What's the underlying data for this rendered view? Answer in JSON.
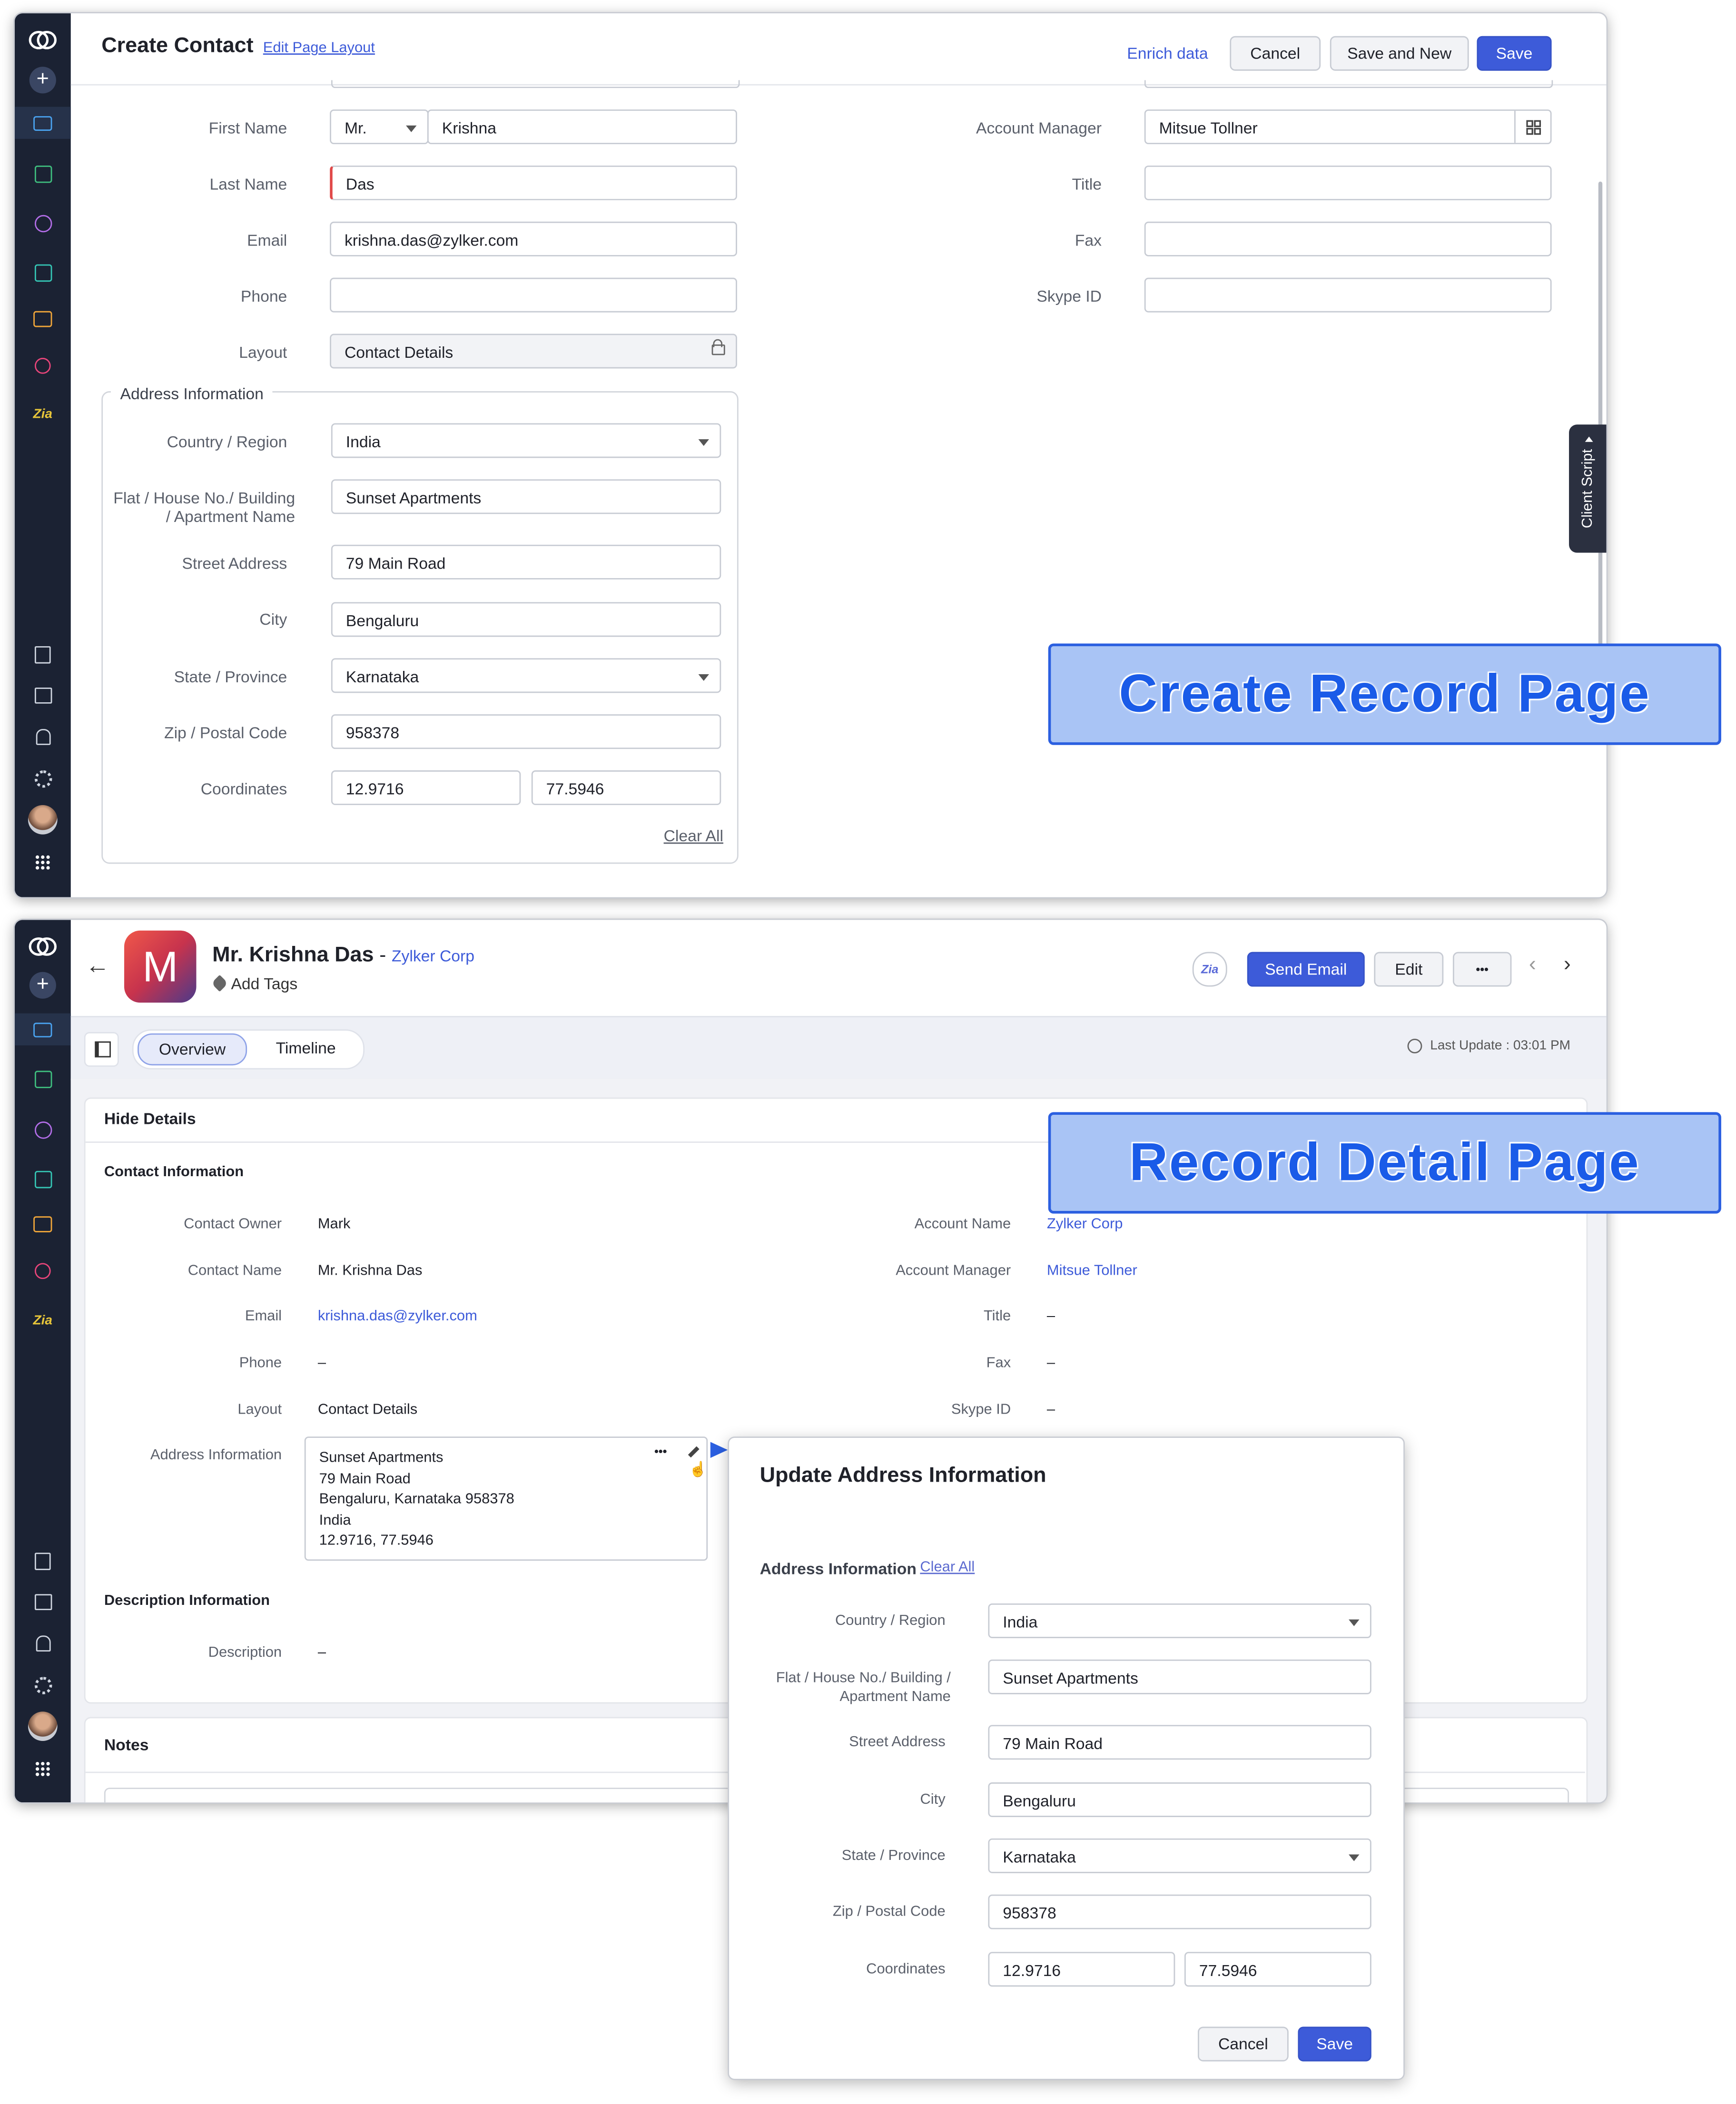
{
  "create_page": {
    "title": "Create Contact",
    "edit_layout": "Edit Page Layout",
    "enrich": "Enrich data",
    "cancel": "Cancel",
    "save_new": "Save and New",
    "save": "Save",
    "labels": {
      "first_name": "First Name",
      "last_name": "Last Name",
      "email": "Email",
      "phone": "Phone",
      "layout": "Layout",
      "account_manager": "Account Manager",
      "title": "Title",
      "fax": "Fax",
      "skype": "Skype ID"
    },
    "values": {
      "salutation": "Mr.",
      "first_name": "Krishna",
      "last_name": "Das",
      "email": "krishna.das@zylker.com",
      "phone": "",
      "layout": "Contact Details",
      "account_manager": "Mitsue Tollner",
      "title": "",
      "fax": "",
      "skype": ""
    },
    "address": {
      "section": "Address Information",
      "country_label": "Country / Region",
      "country": "India",
      "flat_label_1": "Flat / House No./ Building",
      "flat_label_2": "/ Apartment Name",
      "flat": "Sunset Apartments",
      "street_label": "Street Address",
      "street": "79 Main Road",
      "city_label": "City",
      "city": "Bengaluru",
      "state_label": "State / Province",
      "state": "Karnataka",
      "zip_label": "Zip / Postal Code",
      "zip": "958378",
      "coord_label": "Coordinates",
      "lat": "12.9716",
      "lng": "77.5946",
      "clear_all": "Clear All"
    },
    "client_script": "Client Script"
  },
  "detail_page": {
    "avatar_letter": "M",
    "name": "Mr. Krishna Das",
    "separator": " - ",
    "account": "Zylker Corp",
    "add_tags": "Add Tags",
    "send_email": "Send Email",
    "edit": "Edit",
    "more": "•••",
    "tabs": [
      "Overview",
      "Timeline"
    ],
    "last_update": "Last Update : 03:01 PM",
    "hide_details": "Hide Details",
    "contact_info": "Contact Information",
    "fields_left": [
      {
        "label": "Contact Owner",
        "value": "Mark"
      },
      {
        "label": "Contact Name",
        "value": "Mr. Krishna Das"
      },
      {
        "label": "Email",
        "value": "krishna.das@zylker.com"
      },
      {
        "label": "Phone",
        "value": "–"
      },
      {
        "label": "Layout",
        "value": "Contact Details"
      }
    ],
    "fields_right": [
      {
        "label": "Account Name",
        "value": "Zylker Corp"
      },
      {
        "label": "Account Manager",
        "value": "Mitsue Tollner"
      },
      {
        "label": "Title",
        "value": "–"
      },
      {
        "label": "Fax",
        "value": "–"
      },
      {
        "label": "Skype ID",
        "value": "–"
      }
    ],
    "address_label": "Address Information",
    "address_lines": [
      "Sunset Apartments",
      "79 Main Road",
      "Bengaluru, Karnataka 958378",
      "India",
      "12.9716, 77.5946"
    ],
    "desc_section": "Description Information",
    "desc_label": "Description",
    "desc_value": "–",
    "notes": "Notes"
  },
  "popup": {
    "title": "Update Address Information",
    "section": "Address Information",
    "clear_all": "Clear All",
    "country_label": "Country / Region",
    "country": "India",
    "flat_label_1": "Flat / House No./ Building /",
    "flat_label_2": "Apartment Name",
    "flat": "Sunset Apartments",
    "street_label": "Street Address",
    "street": "79 Main Road",
    "city_label": "City",
    "city": "Bengaluru",
    "state_label": "State / Province",
    "state": "Karnataka",
    "zip_label": "Zip / Postal Code",
    "zip": "958378",
    "coord_label": "Coordinates",
    "lat": "12.9716",
    "lng": "77.5946",
    "cancel": "Cancel",
    "save": "Save"
  },
  "banners": {
    "create": "Create Record Page",
    "detail": "Record Detail Page"
  },
  "colors": {
    "accent": "#3d5bd9",
    "sidebar": "#1b2233",
    "required": "#e04848"
  }
}
